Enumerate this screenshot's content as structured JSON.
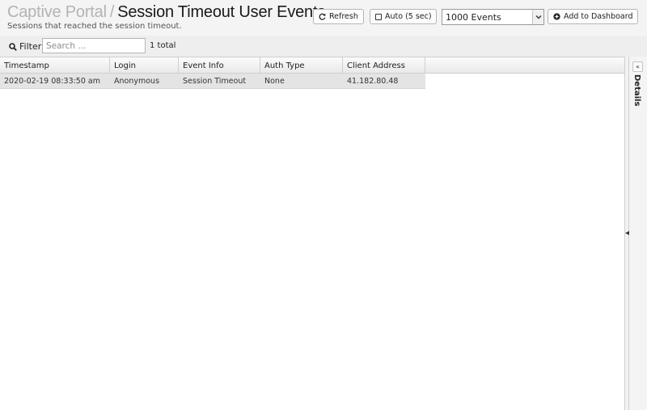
{
  "header": {
    "parent_title": "Captive Portal",
    "separator": "/",
    "title": "Session Timeout User Events",
    "subtitle": "Sessions that reached the session timeout."
  },
  "toolbar": {
    "refresh_label": "Refresh",
    "auto_label": "Auto (5 sec)",
    "auto_checked": false,
    "events_select": {
      "value": "1000 Events"
    },
    "add_dashboard_label": "Add to Dashboard"
  },
  "filter": {
    "label": "Filter",
    "placeholder": "Search ...",
    "value": "",
    "total": "1 total"
  },
  "table": {
    "columns": [
      "Timestamp",
      "Login",
      "Event Info",
      "Auth Type",
      "Client Address"
    ],
    "rows": [
      [
        "2020-02-19 08:33:50 am",
        "Anonymous",
        "Session Timeout",
        "None",
        "41.182.80.48"
      ]
    ]
  },
  "details_panel": {
    "label": "Details"
  },
  "icons": {
    "refresh": "refresh-icon",
    "checkbox": "checkbox-icon",
    "dropdown": "chevron-down-icon",
    "add": "plus-circle-icon",
    "search": "search-icon",
    "collapse": "double-chevron-left-icon",
    "splitter": "caret-left-icon"
  }
}
